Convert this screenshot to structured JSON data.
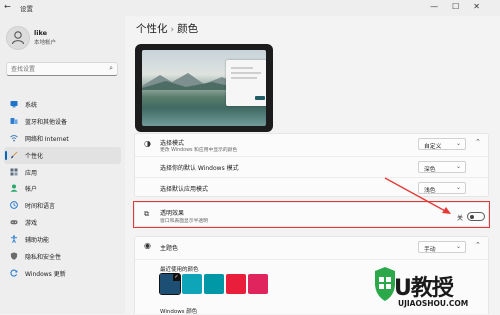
{
  "titlebar": {
    "title": "设置",
    "back_icon": "back-arrow-icon",
    "controls": [
      "—",
      "☐",
      "✕"
    ]
  },
  "user": {
    "name": "like",
    "account": "本地帐户"
  },
  "search": {
    "placeholder": "查找设置"
  },
  "nav": {
    "items": [
      {
        "label": "系统",
        "icon": "monitor-icon",
        "color": "#1f73c8"
      },
      {
        "label": "蓝牙和其他设备",
        "icon": "bluetooth-devices-icon",
        "color": "#2a7dd1"
      },
      {
        "label": "网络和 Internet",
        "icon": "network-icon",
        "color": "#4a7fb3"
      },
      {
        "label": "个性化",
        "icon": "brush-icon",
        "color": "#d88a2a",
        "active": true
      },
      {
        "label": "应用",
        "icon": "apps-icon",
        "color": "#5b6b7c"
      },
      {
        "label": "帐户",
        "icon": "account-icon",
        "color": "#2aa86b"
      },
      {
        "label": "时间和语言",
        "icon": "globe-clock-icon",
        "color": "#2a7dd1"
      },
      {
        "label": "游戏",
        "icon": "game-controller-icon",
        "color": "#6b6b6b"
      },
      {
        "label": "辅助功能",
        "icon": "accessibility-icon",
        "color": "#2a7dd1"
      },
      {
        "label": "隐私和安全性",
        "icon": "shield-icon",
        "color": "#6b6b6b"
      },
      {
        "label": "Windows 更新",
        "icon": "windows-update-icon",
        "color": "#2a7dd1"
      }
    ]
  },
  "breadcrumb": {
    "parent": "个性化",
    "separator": "›",
    "current": "颜色"
  },
  "mode_section": {
    "title": "选择模式",
    "desc": "更改 Windows 和应用中显示的颜色",
    "value": "自定义",
    "rows": [
      {
        "label": "选择你的默认 Windows 模式",
        "value": "深色"
      },
      {
        "label": "选择默认应用模式",
        "value": "浅色"
      }
    ]
  },
  "transparency": {
    "title": "透明效果",
    "desc": "窗口和表面显示半透明",
    "state_label": "关",
    "on": false
  },
  "accent": {
    "title": "主题色",
    "value": "手动",
    "recent_label": "最近使用的颜色",
    "recent_colors": [
      "#1d4e73",
      "#0ea5b8",
      "#0097a7",
      "#e91e3b",
      "#e0245e"
    ],
    "windows_colors_label": "Windows 颜色"
  },
  "watermark": {
    "main": "U教授",
    "sub": "UJIAOSHOU.COM"
  },
  "colors": {
    "accent_blue": "#0067c0",
    "highlight_red": "#e53935",
    "watermark_green": "#2aa84a"
  }
}
